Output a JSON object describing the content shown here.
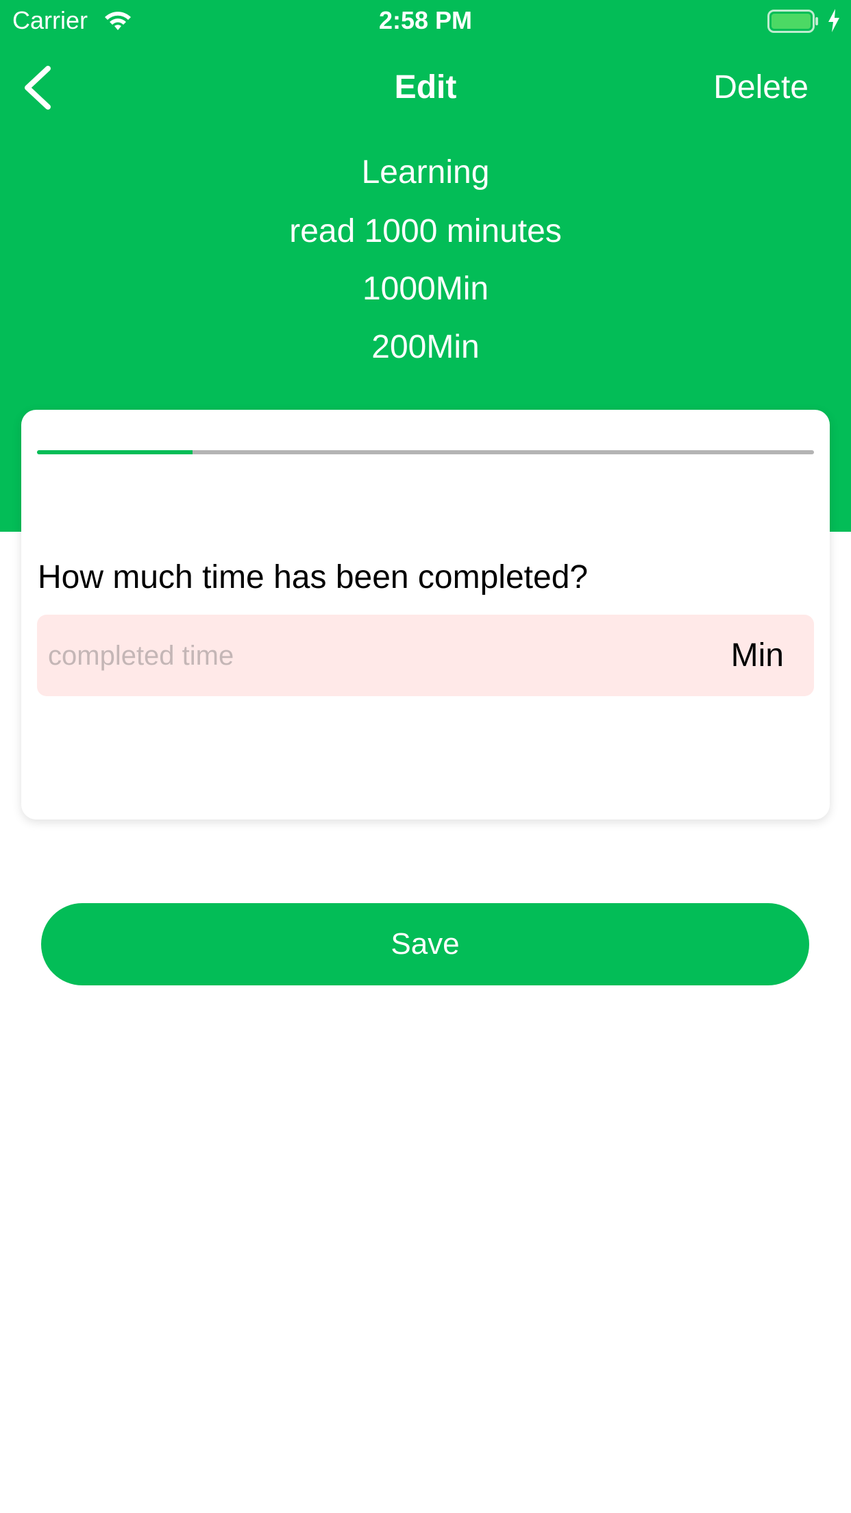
{
  "status_bar": {
    "carrier": "Carrier",
    "time": "2:58 PM",
    "wifi_icon": "wifi-icon",
    "battery_icon": "battery-icon",
    "charging_icon": "charging-bolt-icon",
    "battery_level": 1.0
  },
  "nav": {
    "back_icon": "chevron-left-icon",
    "title": "Edit",
    "delete_label": "Delete"
  },
  "goal": {
    "category": "Learning",
    "name": "read 1000 minutes",
    "target": "1000Min",
    "completed": "200Min"
  },
  "progress": {
    "completed_minutes": 200,
    "target_minutes": 1000,
    "fraction": 0.2
  },
  "form": {
    "question": "How much time has been completed?",
    "input_value": "",
    "input_placeholder": "completed time",
    "unit": "Min"
  },
  "actions": {
    "save_label": "Save"
  },
  "colors": {
    "accent": "#03BD57",
    "input_background": "#FFE9E8",
    "progress_track": "#B4B4B4",
    "placeholder": "#C4B6B6"
  }
}
